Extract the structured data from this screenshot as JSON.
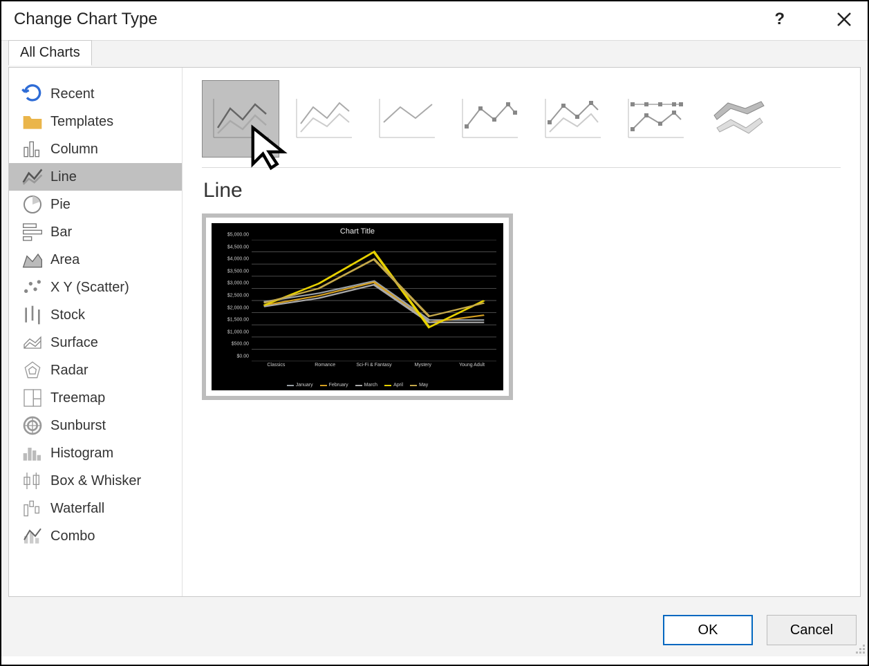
{
  "dialog": {
    "title": "Change Chart Type",
    "help_symbol": "?",
    "tab_label": "All Charts",
    "ok_label": "OK",
    "cancel_label": "Cancel"
  },
  "sidebar": {
    "items": [
      {
        "id": "recent",
        "label": "Recent"
      },
      {
        "id": "templates",
        "label": "Templates"
      },
      {
        "id": "column",
        "label": "Column"
      },
      {
        "id": "line",
        "label": "Line"
      },
      {
        "id": "pie",
        "label": "Pie"
      },
      {
        "id": "bar",
        "label": "Bar"
      },
      {
        "id": "area",
        "label": "Area"
      },
      {
        "id": "xy-scatter",
        "label": "X Y (Scatter)"
      },
      {
        "id": "stock",
        "label": "Stock"
      },
      {
        "id": "surface",
        "label": "Surface"
      },
      {
        "id": "radar",
        "label": "Radar"
      },
      {
        "id": "treemap",
        "label": "Treemap"
      },
      {
        "id": "sunburst",
        "label": "Sunburst"
      },
      {
        "id": "histogram",
        "label": "Histogram"
      },
      {
        "id": "box-whisker",
        "label": "Box & Whisker"
      },
      {
        "id": "waterfall",
        "label": "Waterfall"
      },
      {
        "id": "combo",
        "label": "Combo"
      }
    ],
    "selected_index": 3
  },
  "main": {
    "heading": "Line",
    "selected_subtype_index": 0,
    "subtypes": [
      {
        "name": "line"
      },
      {
        "name": "stacked-line"
      },
      {
        "name": "100-stacked-line"
      },
      {
        "name": "line-with-markers"
      },
      {
        "name": "stacked-line-with-markers"
      },
      {
        "name": "100-stacked-line-with-markers"
      },
      {
        "name": "3d-line"
      }
    ]
  },
  "chart_data": {
    "type": "line",
    "title": "Chart Title",
    "xlabel": "",
    "ylabel": "",
    "ylim": [
      0,
      5000
    ],
    "y_ticks": [
      "$0.00",
      "$500.00",
      "$1,000.00",
      "$1,500.00",
      "$2,000.00",
      "$2,500.00",
      "$3,000.00",
      "$3,500.00",
      "$4,000.00",
      "$4,500.00",
      "$5,000.00"
    ],
    "categories": [
      "Classics",
      "Romance",
      "Sci-Fi & Fantasy",
      "Mystery",
      "Young Adult"
    ],
    "series": [
      {
        "name": "January",
        "color": "#9aa0a6",
        "values": [
          2450,
          2800,
          3300,
          1700,
          1700
        ]
      },
      {
        "name": "February",
        "color": "#d5a021",
        "values": [
          2300,
          2700,
          3250,
          1600,
          1900
        ]
      },
      {
        "name": "March",
        "color": "#aaaaaa",
        "values": [
          2250,
          2600,
          3150,
          1600,
          1600
        ]
      },
      {
        "name": "April",
        "color": "#e7d100",
        "values": [
          2300,
          3200,
          4500,
          1400,
          2500
        ]
      },
      {
        "name": "May",
        "color": "#c4a84a",
        "values": [
          2400,
          3000,
          4200,
          1850,
          2400
        ]
      }
    ]
  }
}
